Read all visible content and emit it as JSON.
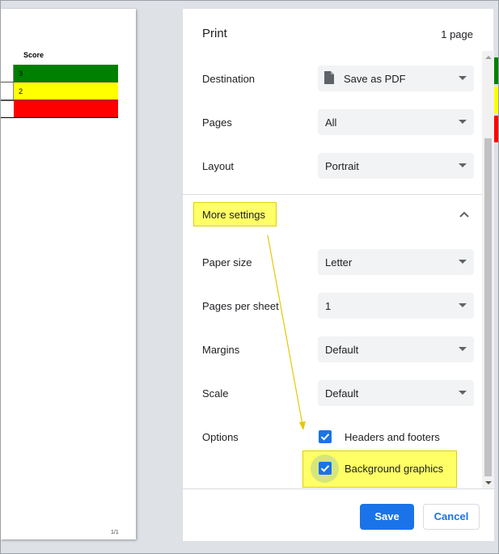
{
  "preview": {
    "score_header": "Score",
    "rows": [
      {
        "value": "3",
        "color": "#008000"
      },
      {
        "value": "2",
        "color": "#ffff00"
      },
      {
        "value": "",
        "color": "#ff0000"
      }
    ],
    "page_number": "1/1"
  },
  "panel": {
    "title": "Print",
    "page_count": "1 page",
    "destination": {
      "label": "Destination",
      "value": "Save as PDF",
      "icon": "document-icon"
    },
    "pages": {
      "label": "Pages",
      "value": "All"
    },
    "layout": {
      "label": "Layout",
      "value": "Portrait"
    },
    "more_settings": {
      "label": "More settings",
      "icon": "chevron-up-icon"
    },
    "paper_size": {
      "label": "Paper size",
      "value": "Letter"
    },
    "pages_per_sheet": {
      "label": "Pages per sheet",
      "value": "1"
    },
    "margins": {
      "label": "Margins",
      "value": "Default"
    },
    "scale": {
      "label": "Scale",
      "value": "Default"
    },
    "options": {
      "label": "Options",
      "headers_footers": {
        "label": "Headers and footers",
        "checked": true
      },
      "background_graphics": {
        "label": "Background graphics",
        "checked": true
      }
    },
    "save_label": "Save",
    "cancel_label": "Cancel"
  },
  "colors": {
    "accent": "#1a73e8",
    "highlight": "#ffff66",
    "annotation_arrow": "#e6c800"
  }
}
